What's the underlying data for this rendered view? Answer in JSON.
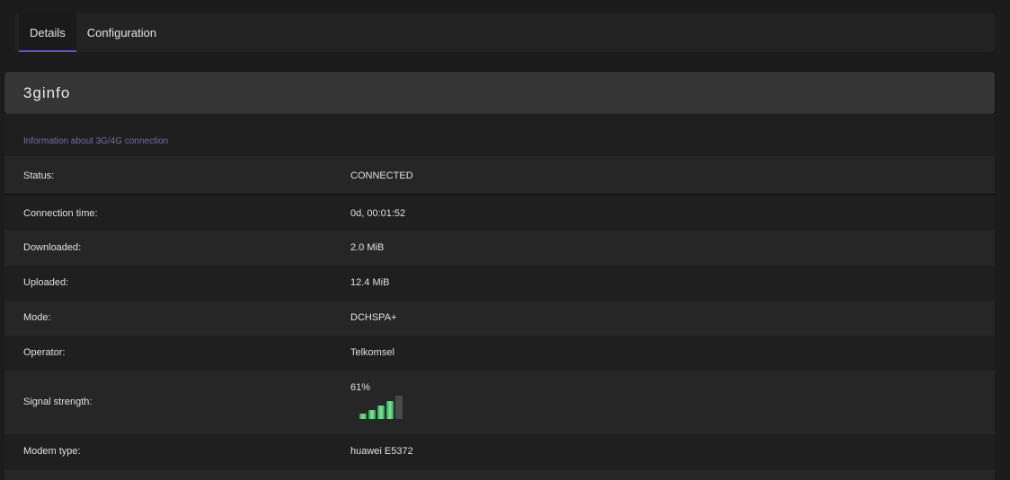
{
  "tabs": [
    {
      "label": "Details",
      "active": true
    },
    {
      "label": "Configuration",
      "active": false
    }
  ],
  "section": {
    "title": "3ginfo",
    "description": "Information about 3G/4G connection"
  },
  "rows": {
    "status": {
      "label": "Status:",
      "value": "CONNECTED"
    },
    "connection_time": {
      "label": "Connection time:",
      "value": "0d, 00:01:52"
    },
    "downloaded": {
      "label": "Downloaded:",
      "value": "2.0 MiB"
    },
    "uploaded": {
      "label": "Uploaded:",
      "value": "12.4 MiB"
    },
    "mode": {
      "label": "Mode:",
      "value": "DCHSPA+"
    },
    "operator": {
      "label": "Operator:",
      "value": "Telkomsel"
    },
    "signal": {
      "label": "Signal strength:",
      "value": "61%",
      "bars_active": 4,
      "bars_total": 5
    },
    "modem_type": {
      "label": "Modem type:",
      "value": "huawei E5372"
    }
  },
  "colors": {
    "accent": "#6a4fc8",
    "signal_on": "#4fd673",
    "signal_off": "#4a4a4a",
    "description": "#6d6fa8"
  }
}
